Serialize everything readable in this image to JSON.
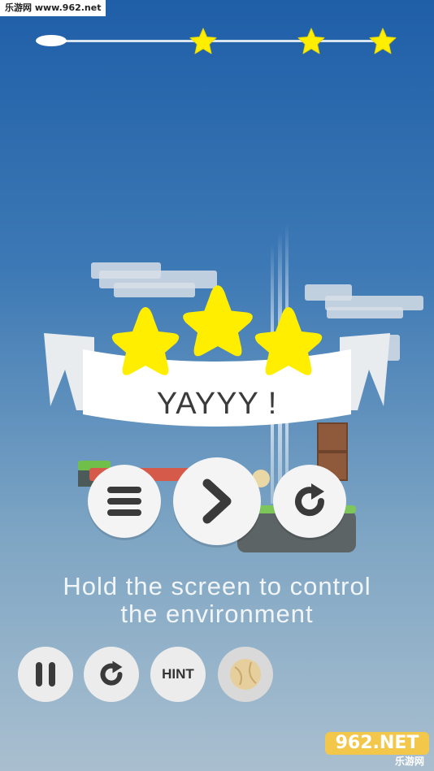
{
  "watermark_top": "乐游网 www.962.net",
  "progress": {
    "value": 0.0,
    "star_count": 3
  },
  "result": {
    "title": "YAYYY !",
    "stars_earned": 3
  },
  "instruction": {
    "line1": "Hold the screen to control",
    "line2": "the environment"
  },
  "bottom_bar": {
    "hint_label": "HINT"
  },
  "watermark_bottom": {
    "brand": "962.NET",
    "sub": "乐游网"
  },
  "colors": {
    "star": "#ffee00",
    "banner": "#ffffff",
    "button": "#ececec",
    "icon": "#3a3a3a"
  }
}
